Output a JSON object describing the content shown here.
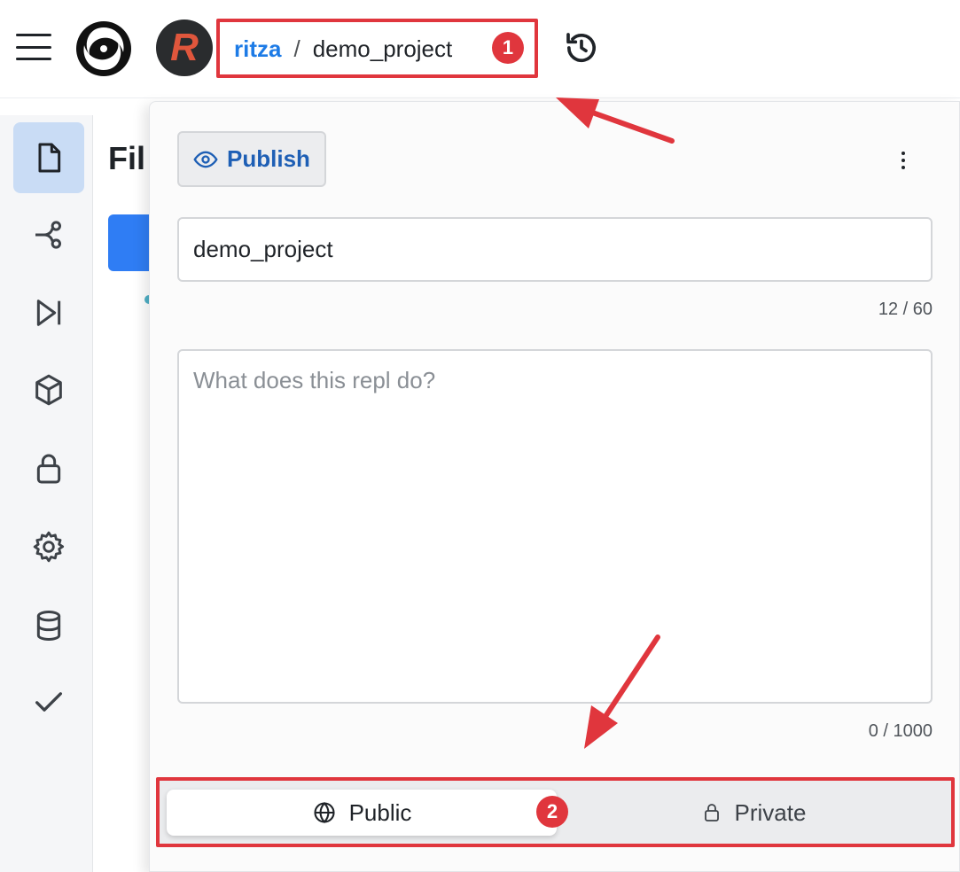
{
  "header": {
    "avatar_letter": "R",
    "breadcrumb": {
      "owner": "ritza",
      "separator": "/",
      "project": "demo_project"
    },
    "icons": [
      "hamburger-menu-icon",
      "app-logo",
      "history-icon"
    ]
  },
  "sidebar": {
    "items": [
      {
        "icon": "file-icon",
        "active": true
      },
      {
        "icon": "version-control-icon",
        "active": false
      },
      {
        "icon": "run-icon",
        "active": false
      },
      {
        "icon": "package-icon",
        "active": false
      },
      {
        "icon": "lock-icon",
        "active": false
      },
      {
        "icon": "settings-icon",
        "active": false
      },
      {
        "icon": "database-icon",
        "active": false
      },
      {
        "icon": "check-icon",
        "active": false
      }
    ]
  },
  "files_panel": {
    "title_partial": "Fil"
  },
  "popover": {
    "publish_label": "Publish",
    "title_value": "demo_project",
    "title_counter": "12 / 60",
    "description_placeholder": "What does this repl do?",
    "description_counter": "0 / 1000",
    "visibility": {
      "public_label": "Public",
      "private_label": "Private",
      "selected": "Public"
    }
  },
  "annotations": {
    "badge_1": "1",
    "badge_2": "2",
    "highlight_color": "#e0363d"
  },
  "colors": {
    "accent": "#1d7be6",
    "active_rail": "#c9dcf5",
    "publish_text": "#1e5fb5"
  }
}
